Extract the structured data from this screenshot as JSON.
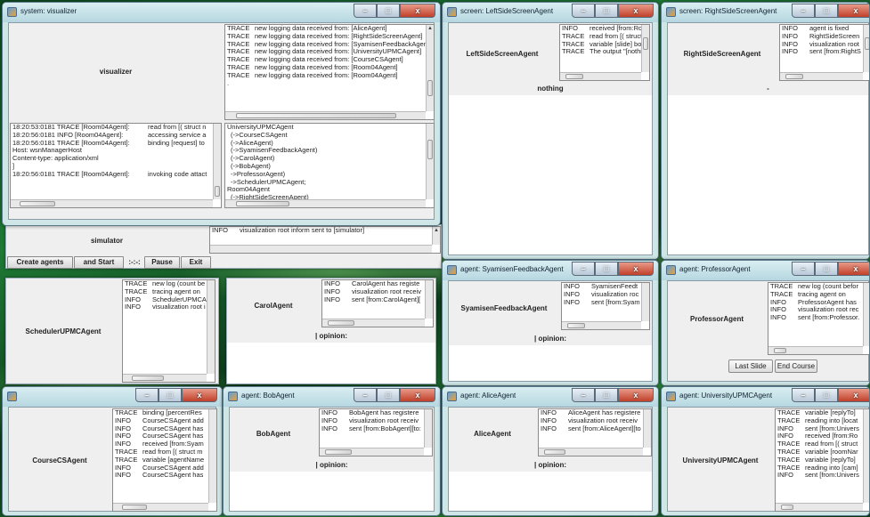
{
  "visualizer": {
    "title": "system: visualizer",
    "name": "visualizer",
    "log_top": [
      [
        "TRACE",
        "new logging data received from: [AliceAgent]"
      ],
      [
        "TRACE",
        "new logging data received from: [RightSideScreenAgent]"
      ],
      [
        "TRACE",
        "new logging data received from: [SyamisenFeedbackAgent]"
      ],
      [
        "TRACE",
        "new logging data received from: [UniversityUPMCAgent]"
      ],
      [
        "TRACE",
        "new logging data received from: [CourseCSAgent]"
      ],
      [
        "TRACE",
        "new logging data received from: [Room04Agent]"
      ],
      [
        "TRACE",
        "new logging data received from: [Room04Agent]"
      ],
      [
        ".",
        ""
      ]
    ],
    "log_left": [
      [
        "18:20:53:0181 TRACE [Room04Agent]:",
        "read from [( struct n"
      ],
      [
        "18:20:56:0181 INFO [Room04Agent]:",
        "accessing service a"
      ],
      [
        "18:20:56:0181 TRACE [Room04Agent]:",
        "binding [request] to"
      ],
      [
        "Host: wsnManagerHost",
        ""
      ],
      [
        "Content-type: application/xml",
        ""
      ],
      [
        "]",
        ""
      ],
      [
        "18:20:56:0181 TRACE [Room04Agent]:",
        "invoking code attact"
      ]
    ],
    "tree": [
      "UniversityUPMCAgent",
      "(->CourseCSAgent",
      "(->AliceAgent)",
      "(->SyamisenFeedbackAgent)",
      "(->CarolAgent)",
      "(->BobAgent)",
      "->ProfessorAgent)",
      "->SchedulerUPMCAgent;",
      "Room04Agent",
      "(->RightSideScreenAgent)"
    ]
  },
  "simulator": {
    "name": "simulator",
    "log": [
      [
        "INFO",
        "visualization root inform sent to [simulator]"
      ]
    ],
    "buttons": [
      "Create agents",
      "and Start",
      ":-:-:",
      "Pause",
      "Exit"
    ]
  },
  "left_screen": {
    "title": "screen: LeftSideScreenAgent",
    "name": "LeftSideScreenAgent",
    "status": "nothing",
    "log": [
      [
        "INFO",
        "received [from:Ro"
      ],
      [
        "TRACE",
        "read from [( struct"
      ],
      [
        "TRACE",
        "variable [slide] bo"
      ],
      [
        "TRACE",
        "The output \"[nothi"
      ]
    ]
  },
  "right_screen": {
    "title": "screen: RightSideScreenAgent",
    "name": "RightSideScreenAgent",
    "status": "-",
    "log": [
      [
        "INFO",
        "agent is fixed"
      ],
      [
        "INFO",
        "RightSideScreen"
      ],
      [
        "INFO",
        "visualization root"
      ],
      [
        "INFO",
        "sent [from:RightS"
      ]
    ]
  },
  "scheduler": {
    "name": "SchedulerUPMCAgent",
    "log": [
      [
        "TRACE",
        "new log (count be"
      ],
      [
        "TRACE",
        "tracing agent on"
      ],
      [
        "INFO",
        "SchedulerUPMCA"
      ],
      [
        "INFO",
        "visualization root i"
      ]
    ]
  },
  "carol": {
    "name": "CarolAgent",
    "opinion": "| opinion:",
    "log": [
      [
        "INFO",
        "CarolAgent has registe"
      ],
      [
        "INFO",
        "visualization root receiv"
      ],
      [
        "INFO",
        "sent [from:CarolAgent]["
      ]
    ]
  },
  "syamisen": {
    "title": "agent: SyamisenFeedbackAgent",
    "name": "SyamisenFeedbackAgent",
    "opinion": "| opinion:",
    "log": [
      [
        "INFO",
        "SyamisenFeedt"
      ],
      [
        "INFO",
        "visualization roc"
      ],
      [
        "INFO",
        "sent [from:Syam"
      ]
    ]
  },
  "professor": {
    "title": "agent: ProfessorAgent",
    "name": "ProfessorAgent",
    "buttons": [
      "Last Slide",
      "End Course"
    ],
    "log": [
      [
        "TRACE",
        "new log (count befor"
      ],
      [
        "TRACE",
        "tracing agent on"
      ],
      [
        "INFO",
        "ProfessorAgent has"
      ],
      [
        "INFO",
        "visualization root rec"
      ],
      [
        "INFO",
        "sent [from:Professor."
      ]
    ]
  },
  "course": {
    "name": "CourseCSAgent",
    "log": [
      [
        "TRACE",
        "binding [percentRes"
      ],
      [
        "INFO",
        "CourseCSAgent add"
      ],
      [
        "INFO",
        "CourseCSAgent has"
      ],
      [
        "INFO",
        "CourseCSAgent has"
      ],
      [
        "INFO",
        "received [from:Syam"
      ],
      [
        "TRACE",
        "read from [( struct m"
      ],
      [
        "TRACE",
        "variable [agentName"
      ],
      [
        "INFO",
        "CourseCSAgent add"
      ],
      [
        "INFO",
        "CourseCSAgent has"
      ]
    ]
  },
  "bob": {
    "title": "agent: BobAgent",
    "name": "BobAgent",
    "opinion": "| opinion:",
    "log": [
      [
        "INFO",
        "BobAgent has registere"
      ],
      [
        "INFO",
        "visualization root receiv"
      ],
      [
        "INFO",
        "sent [from:BobAgent][to:"
      ]
    ]
  },
  "alice": {
    "title": "agent: AliceAgent",
    "name": "AliceAgent",
    "opinion": "| opinion:",
    "log": [
      [
        "INFO",
        "AliceAgent has registere"
      ],
      [
        "INFO",
        "visualization root receiv"
      ],
      [
        "INFO",
        "sent [from:AliceAgent][to"
      ]
    ]
  },
  "university": {
    "title": "agent: UniversityUPMCAgent",
    "name": "UniversityUPMCAgent",
    "log": [
      [
        "TRACE",
        "variable [replyTo]"
      ],
      [
        "TRACE",
        "reading into [locat"
      ],
      [
        "INFO",
        "sent [from:Univers"
      ],
      [
        "INFO",
        "received [from:Ro"
      ],
      [
        "TRACE",
        "read from [( struct"
      ],
      [
        "TRACE",
        "variable [roomNar"
      ],
      [
        "TRACE",
        "variable [replyTo]"
      ],
      [
        "TRACE",
        "reading into [cam]"
      ],
      [
        "INFO",
        "sent [from:Univers"
      ]
    ]
  },
  "icons": {
    "minimize": "minimize-icon",
    "maximize": "maximize-icon",
    "close": "close-icon"
  }
}
